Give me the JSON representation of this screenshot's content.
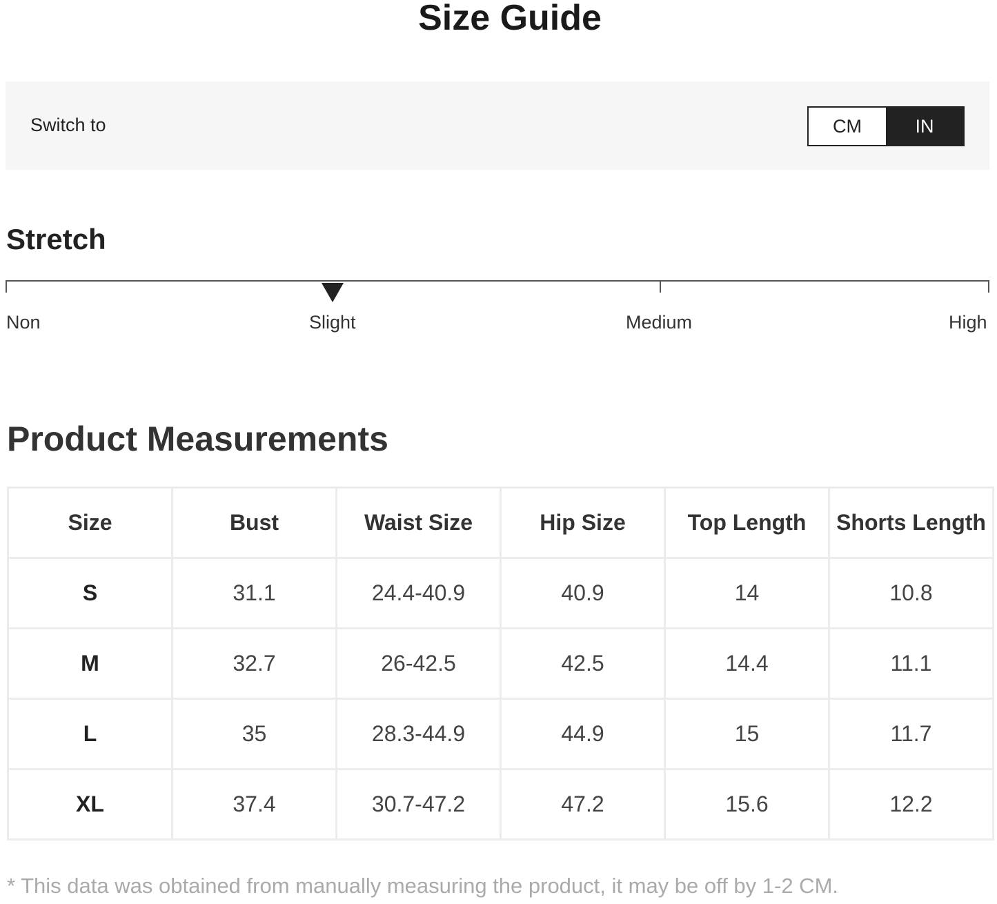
{
  "title": "Size Guide",
  "unit_switch": {
    "label": "Switch to",
    "options": [
      "CM",
      "IN"
    ],
    "selected": "IN"
  },
  "stretch": {
    "title": "Stretch",
    "levels": [
      "Non",
      "Slight",
      "Medium",
      "High"
    ],
    "selected": "Slight"
  },
  "measurements": {
    "title": "Product Measurements",
    "columns": [
      "Size",
      "Bust",
      "Waist Size",
      "Hip Size",
      "Top Length",
      "Shorts Length"
    ],
    "rows": [
      [
        "S",
        "31.1",
        "24.4-40.9",
        "40.9",
        "14",
        "10.8"
      ],
      [
        "M",
        "32.7",
        "26-42.5",
        "42.5",
        "14.4",
        "11.1"
      ],
      [
        "L",
        "35",
        "28.3-44.9",
        "44.9",
        "15",
        "11.7"
      ],
      [
        "XL",
        "37.4",
        "30.7-47.2",
        "47.2",
        "15.6",
        "12.2"
      ]
    ]
  },
  "footnote": "* This data was obtained from manually measuring the product, it may be off by 1-2 CM.",
  "colors": {
    "selected_bg": "#222222",
    "panel_bg": "#f6f6f6",
    "border": "#ececec",
    "footnote": "#aaaaaa"
  }
}
